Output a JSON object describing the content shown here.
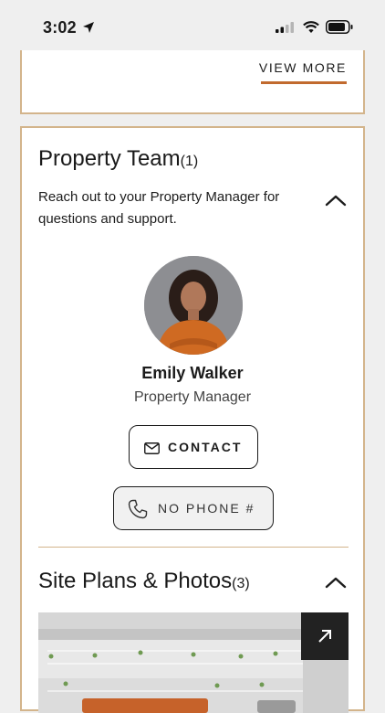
{
  "status_bar": {
    "time": "3:02"
  },
  "previous_section": {
    "view_more_label": "VIEW MORE"
  },
  "property_team": {
    "title": "Property Team",
    "count": "(1)",
    "description": "Reach out to your Property Manager for questions and support.",
    "manager": {
      "name": "Emily Walker",
      "role": "Property Manager"
    },
    "contact_label": "CONTACT",
    "phone_label": "NO PHONE #"
  },
  "site_plans": {
    "title": "Site Plans & Photos",
    "count": "(3)"
  },
  "colors": {
    "accent": "#c16a2e",
    "card_border": "#d3b48b"
  }
}
